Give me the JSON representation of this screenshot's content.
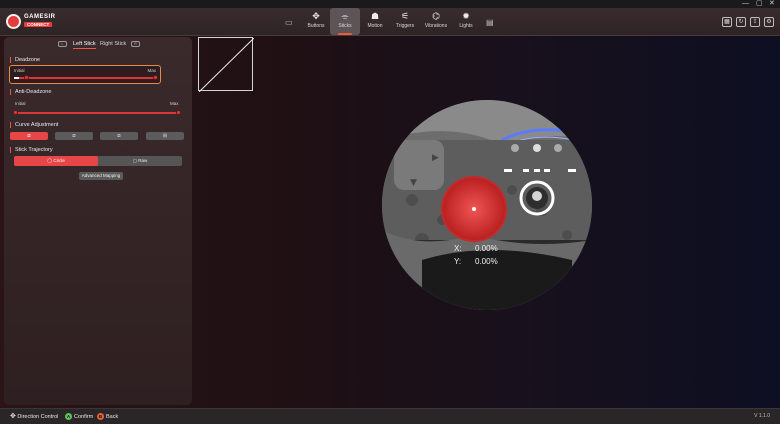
{
  "app": {
    "logo_text": "GAMESIR",
    "logo_sub": "CONNECT",
    "window_controls": [
      "—",
      "▢",
      "✕"
    ]
  },
  "nav": [
    {
      "label": "Buttons",
      "icon": "dpad-icon"
    },
    {
      "label": "Sticks",
      "icon": "stick-icon",
      "active": true
    },
    {
      "label": "Motion",
      "icon": "motion-icon"
    },
    {
      "label": "Triggers",
      "icon": "trigger-icon"
    },
    {
      "label": "Vibrations",
      "icon": "vibration-icon"
    },
    {
      "label": "Lights",
      "icon": "light-icon"
    }
  ],
  "panel": {
    "tabs": {
      "left": "Left Stick",
      "right": "Right Stick"
    },
    "deadzone": {
      "title": "Deadzone",
      "initial_label": "Initial",
      "max_label": "Max"
    },
    "anti_deadzone": {
      "title": "Anti-Deadzone",
      "initial_label": "Initial",
      "max_label": "Max"
    },
    "curve": {
      "title": "Curve Adjustment"
    },
    "trajectory": {
      "title": "Stick Trajectory",
      "circle": "Circle",
      "raw": "Raw"
    },
    "advanced_button": "Advanced Mapping"
  },
  "readout": {
    "x_label": "X:",
    "x_value": "0.00%",
    "y_label": "Y:",
    "y_value": "0.00%"
  },
  "footer": {
    "direction": "Direction Control",
    "confirm_key": "A",
    "confirm": "Confirm",
    "back_key": "B",
    "back": "Back",
    "version": "V 1.1.0"
  },
  "colors": {
    "accent": "#e64646",
    "highlight": "#e85c3e"
  }
}
